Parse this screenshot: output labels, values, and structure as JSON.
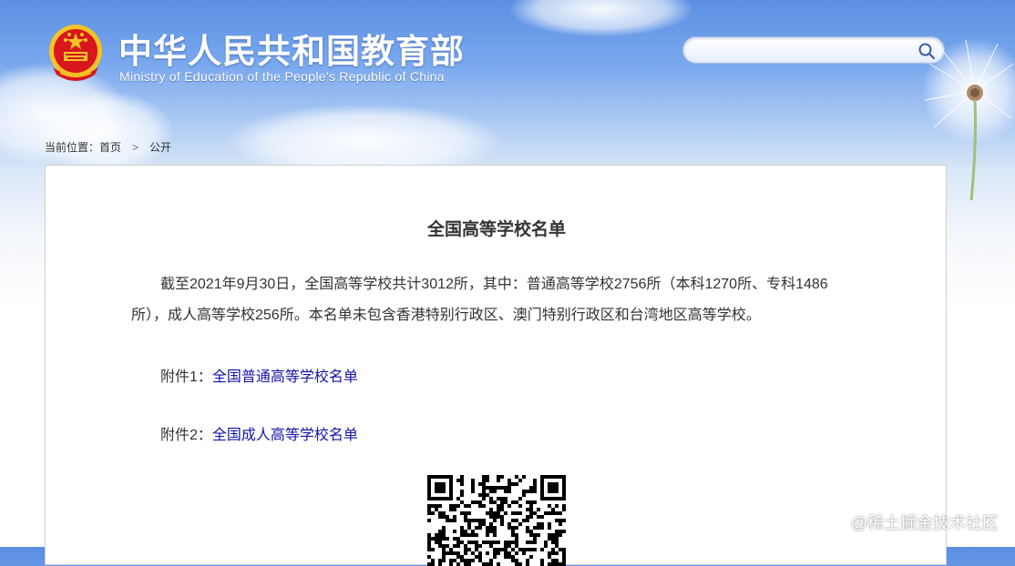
{
  "header": {
    "title_cn": "中华人民共和国教育部",
    "title_en": "Ministry of Education of the People's Republic of China"
  },
  "search": {
    "placeholder": "",
    "icon": "search-icon"
  },
  "breadcrumb": {
    "prefix": "当前位置：",
    "items": [
      "首页",
      "公开"
    ],
    "separator": ">"
  },
  "article": {
    "title": "全国高等学校名单",
    "paragraph": "截至2021年9月30日，全国高等学校共计3012所，其中：普通高等学校2756所（本科1270所、专科1486所），成人高等学校256所。本名单未包含香港特别行政区、澳门特别行政区和台湾地区高等学校。",
    "attachments": [
      {
        "label": "附件1：",
        "link": "全国普通高等学校名单"
      },
      {
        "label": "附件2：",
        "link": "全国成人高等学校名单"
      }
    ]
  },
  "watermark": "@稀土掘金技术社区",
  "colors": {
    "link": "#1414a6",
    "text": "#333333",
    "sky_top": "#5b8fe2",
    "emblem_red": "#d8161c",
    "emblem_gold": "#f6c324"
  }
}
